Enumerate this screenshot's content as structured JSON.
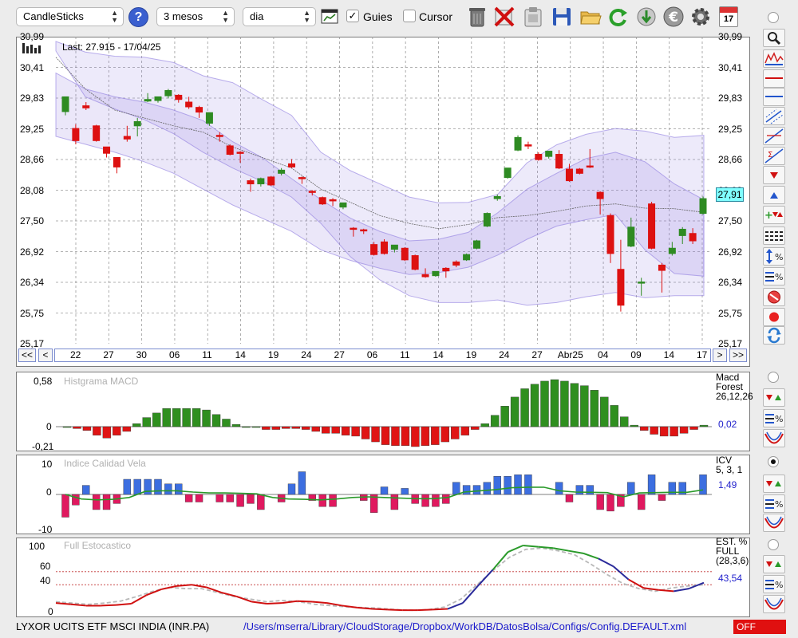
{
  "toolbar": {
    "chart_type": "CandleSticks",
    "period": "3 mesos",
    "interval": "dia",
    "guides_label": "Guies",
    "guides_checked": true,
    "cursor_label": "Cursor",
    "cursor_checked": false,
    "calendar_day": "17"
  },
  "price_chart": {
    "last_text": "Last: 27.915 - 17/04/25",
    "last_value_label": "27,91",
    "y_labels": [
      "30,99",
      "30,41",
      "29,83",
      "29,25",
      "28,66",
      "28,08",
      "27,50",
      "26,92",
      "26,34",
      "25,75",
      "25,17"
    ],
    "x_labels": [
      "22",
      "27",
      "30",
      "06",
      "11",
      "14",
      "19",
      "24",
      "27",
      "06",
      "11",
      "14",
      "19",
      "24",
      "27",
      "Abr25",
      "04",
      "09",
      "14",
      "17"
    ],
    "nav_buttons": [
      "<<",
      "<",
      ">",
      ">>"
    ]
  },
  "macd": {
    "title": "Histgrama MACD",
    "y_labels": [
      "0,58",
      "0",
      "-0,21"
    ],
    "info_lines": [
      "Macd",
      "Forest",
      "26,12,26"
    ],
    "value": "0,02"
  },
  "icv": {
    "title": "Indice Calidad Vela",
    "y_labels": [
      "10",
      "0",
      "-10"
    ],
    "info_lines": [
      "ICV",
      "5, 3, 1"
    ],
    "value": "1,49"
  },
  "stoch": {
    "title": "Full Estocastico",
    "y_labels": [
      "100",
      "60",
      "40",
      "0"
    ],
    "info_lines": [
      "EST. %",
      "FULL",
      "(28,3,6)"
    ],
    "value": "43,54"
  },
  "status": {
    "instrument": "LYXOR UCITS ETF MSCI INDIA (INR.PA)",
    "config_path": "/Users/mserra/Library/CloudStorage/Dropbox/WorkDB/DatosBolsa/Configs/Config.DEFAULT.xml",
    "state": "OFF"
  },
  "colors": {
    "up": "#2e8b22",
    "down": "#dd1111",
    "band": "#8e7ce0",
    "macd_up": "#2f8f1f",
    "macd_down": "#e01414",
    "icv_up": "#3c6ee0",
    "icv_down": "#e0195f",
    "status_off": "#e01010"
  },
  "chart_data": {
    "type": "candlestick",
    "ylim": [
      25.17,
      30.99
    ],
    "candles": [
      {
        "o": 29.57,
        "h": 29.62,
        "c": 29.85,
        "l": 29.5
      },
      {
        "o": 29.25,
        "h": 29.33,
        "c": 29.02,
        "l": 28.95
      },
      {
        "o": 29.68,
        "h": 29.75,
        "c": 29.64,
        "l": 29.6
      },
      {
        "o": 29.3,
        "h": 29.32,
        "c": 29.02,
        "l": 29.0
      },
      {
        "o": 28.9,
        "h": 28.9,
        "c": 28.78,
        "l": 28.7
      },
      {
        "o": 28.7,
        "h": 28.7,
        "c": 28.52,
        "l": 28.4
      },
      {
        "o": 29.1,
        "h": 29.3,
        "c": 29.05,
        "l": 29.0
      },
      {
        "o": 29.3,
        "h": 29.45,
        "c": 29.38,
        "l": 29.1
      },
      {
        "o": 29.77,
        "h": 29.92,
        "c": 29.8,
        "l": 29.75
      },
      {
        "o": 29.78,
        "h": 29.8,
        "c": 29.85,
        "l": 29.74
      },
      {
        "o": 29.87,
        "h": 30.0,
        "c": 29.97,
        "l": 29.82
      },
      {
        "o": 29.88,
        "h": 29.9,
        "c": 29.8,
        "l": 29.74
      },
      {
        "o": 29.75,
        "h": 29.85,
        "c": 29.66,
        "l": 29.62
      },
      {
        "o": 29.65,
        "h": 29.68,
        "c": 29.56,
        "l": 29.45
      },
      {
        "o": 29.35,
        "h": 29.55,
        "c": 29.55,
        "l": 29.3
      },
      {
        "o": 29.12,
        "h": 29.18,
        "c": 29.1,
        "l": 29.0
      },
      {
        "o": 28.92,
        "h": 28.95,
        "c": 28.76,
        "l": 28.74
      },
      {
        "o": 28.8,
        "h": 28.82,
        "c": 28.78,
        "l": 28.6
      },
      {
        "o": 28.26,
        "h": 28.3,
        "c": 28.2,
        "l": 28.05
      },
      {
        "o": 28.2,
        "h": 28.32,
        "c": 28.3,
        "l": 28.15
      },
      {
        "o": 28.33,
        "h": 28.35,
        "c": 28.18,
        "l": 28.16
      },
      {
        "o": 28.4,
        "h": 28.5,
        "c": 28.46,
        "l": 28.36
      },
      {
        "o": 28.58,
        "h": 28.67,
        "c": 28.52,
        "l": 28.5
      },
      {
        "o": 28.32,
        "h": 28.34,
        "c": 28.3,
        "l": 28.2
      },
      {
        "o": 28.06,
        "h": 28.08,
        "c": 28.04,
        "l": 27.98
      },
      {
        "o": 27.94,
        "h": 27.96,
        "c": 27.82,
        "l": 27.8
      },
      {
        "o": 27.9,
        "h": 27.93,
        "c": 27.88,
        "l": 27.78
      },
      {
        "o": 27.76,
        "h": 27.84,
        "c": 27.84,
        "l": 27.72
      },
      {
        "o": 27.36,
        "h": 27.38,
        "c": 27.34,
        "l": 27.2
      },
      {
        "o": 27.33,
        "h": 27.35,
        "c": 27.32,
        "l": 27.25
      },
      {
        "o": 27.05,
        "h": 27.1,
        "c": 26.86,
        "l": 26.84
      },
      {
        "o": 27.1,
        "h": 27.15,
        "c": 26.88,
        "l": 26.86
      },
      {
        "o": 26.96,
        "h": 27.0,
        "c": 27.04,
        "l": 26.9
      },
      {
        "o": 26.98,
        "h": 27.0,
        "c": 26.76,
        "l": 26.74
      },
      {
        "o": 26.84,
        "h": 26.86,
        "c": 26.58,
        "l": 26.56
      },
      {
        "o": 26.48,
        "h": 26.6,
        "c": 26.44,
        "l": 26.42
      },
      {
        "o": 26.46,
        "h": 26.5,
        "c": 26.54,
        "l": 26.44
      },
      {
        "o": 26.6,
        "h": 26.62,
        "c": 26.55,
        "l": 26.42
      },
      {
        "o": 26.72,
        "h": 26.75,
        "c": 26.66,
        "l": 26.62
      },
      {
        "o": 26.76,
        "h": 26.88,
        "c": 26.86,
        "l": 26.74
      },
      {
        "o": 26.98,
        "h": 27.14,
        "c": 27.12,
        "l": 26.96
      },
      {
        "o": 27.4,
        "h": 27.66,
        "c": 27.64,
        "l": 27.38
      },
      {
        "o": 27.92,
        "h": 28.0,
        "c": 27.96,
        "l": 27.88
      },
      {
        "o": 28.32,
        "h": 28.34,
        "c": 28.5,
        "l": 28.3
      },
      {
        "o": 28.84,
        "h": 29.12,
        "c": 29.08,
        "l": 28.82
      },
      {
        "o": 28.94,
        "h": 29.0,
        "c": 28.92,
        "l": 28.86
      },
      {
        "o": 28.76,
        "h": 28.8,
        "c": 28.66,
        "l": 28.64
      },
      {
        "o": 28.72,
        "h": 28.82,
        "c": 28.82,
        "l": 28.68
      },
      {
        "o": 28.76,
        "h": 28.84,
        "c": 28.5,
        "l": 28.48
      },
      {
        "o": 28.48,
        "h": 28.58,
        "c": 28.26,
        "l": 28.24
      },
      {
        "o": 28.48,
        "h": 28.5,
        "c": 28.4,
        "l": 28.38
      },
      {
        "o": 28.54,
        "h": 28.86,
        "c": 28.52,
        "l": 28.5
      },
      {
        "o": 28.04,
        "h": 28.06,
        "c": 27.92,
        "l": 27.62
      },
      {
        "o": 27.6,
        "h": 27.64,
        "c": 26.88,
        "l": 26.7
      },
      {
        "o": 26.58,
        "h": 27.14,
        "c": 25.9,
        "l": 25.78
      },
      {
        "o": 27.02,
        "h": 27.56,
        "c": 27.38,
        "l": 27.0
      },
      {
        "o": 26.34,
        "h": 26.42,
        "c": 26.34,
        "l": 26.08
      },
      {
        "o": 27.82,
        "h": 27.86,
        "c": 26.98,
        "l": 26.96
      },
      {
        "o": 26.66,
        "h": 26.7,
        "c": 26.56,
        "l": 26.14
      },
      {
        "o": 26.88,
        "h": 27.1,
        "c": 26.98,
        "l": 26.84
      },
      {
        "o": 27.22,
        "h": 27.38,
        "c": 27.34,
        "l": 27.06
      },
      {
        "o": 27.26,
        "h": 27.36,
        "c": 27.12,
        "l": 27.06
      },
      {
        "o": 27.64,
        "h": 27.96,
        "c": 27.92,
        "l": 27.62
      }
    ],
    "bands": {
      "upper": [
        30.9,
        30.7,
        30.62,
        30.6,
        30.5,
        30.25,
        30.12,
        29.8,
        29.5,
        28.8,
        28.45,
        28.2,
        27.95,
        27.84,
        27.85,
        28.0,
        28.6,
        28.94,
        29.14,
        29.25,
        29.2,
        29.08,
        29.12
      ],
      "upper2": [
        30.3,
        30.0,
        29.85,
        29.75,
        29.6,
        29.4,
        29.0,
        28.7,
        28.3,
        27.9,
        27.55,
        27.3,
        27.12,
        27.15,
        27.28,
        27.65,
        28.1,
        28.4,
        28.68,
        28.8,
        28.62,
        28.2,
        27.9
      ],
      "middle": [
        30.6,
        30.0,
        29.6,
        29.45,
        29.3,
        29.18,
        28.9,
        28.7,
        28.5,
        28.1,
        27.85,
        27.6,
        27.45,
        27.35,
        27.43,
        27.56,
        27.6,
        27.68,
        27.78,
        27.82,
        27.74,
        27.73,
        27.66
      ],
      "lower2": [
        29.1,
        28.95,
        28.8,
        28.62,
        28.4,
        28.1,
        27.8,
        27.55,
        27.3,
        26.95,
        26.75,
        26.6,
        26.48,
        26.52,
        26.62,
        26.85,
        27.15,
        27.4,
        27.52,
        27.62,
        26.95,
        26.5,
        26.45
      ],
      "lower": [
        30.72,
        29.85,
        29.62,
        29.42,
        29.15,
        28.8,
        28.5,
        28.25,
        27.95,
        27.45,
        26.82,
        26.38,
        26.08,
        25.95,
        25.95,
        26.0,
        25.9,
        25.95,
        26.06,
        26.14,
        26.04,
        26.08,
        26.08
      ]
    },
    "macd_hist": [
      0.0,
      -0.02,
      -0.04,
      -0.09,
      -0.12,
      -0.09,
      -0.05,
      0.04,
      0.12,
      0.18,
      0.24,
      0.24,
      0.24,
      0.24,
      0.22,
      0.16,
      0.1,
      0.03,
      0.0,
      0.0,
      -0.03,
      -0.03,
      -0.02,
      -0.02,
      -0.03,
      -0.05,
      -0.07,
      -0.07,
      -0.09,
      -0.1,
      -0.13,
      -0.16,
      -0.19,
      -0.2,
      -0.2,
      -0.21,
      -0.2,
      -0.19,
      -0.16,
      -0.13,
      -0.09,
      -0.03,
      0.04,
      0.15,
      0.27,
      0.39,
      0.5,
      0.56,
      0.6,
      0.62,
      0.6,
      0.57,
      0.54,
      0.48,
      0.39,
      0.28,
      0.13,
      0.02,
      -0.04,
      -0.08,
      -0.1,
      -0.1,
      -0.07,
      -0.03,
      0.02
    ],
    "icv_bars": [
      -7.5,
      -3.5,
      3.0,
      -5.0,
      -5.0,
      -3.0,
      5.0,
      5.0,
      5.0,
      5.0,
      3.5,
      3.5,
      -2.5,
      -2.5,
      0,
      -2.5,
      -2.5,
      -4.0,
      -3.0,
      -5.0,
      0,
      -2.5,
      3.5,
      7.5,
      -2.0,
      -4.0,
      -4.0,
      0,
      0,
      -2.0,
      -6.0,
      2.5,
      -5.0,
      2.0,
      -3.0,
      -4.0,
      -4.0,
      -3.0,
      4.0,
      3.0,
      3.0,
      4.0,
      6.0,
      6.0,
      6.5,
      6.5,
      0,
      0,
      4.0,
      -2.5,
      3.0,
      3.0,
      -5.0,
      -5.5,
      -4.0,
      4.0,
      -5.0,
      6.5,
      -2.0,
      4.0,
      4.0,
      0,
      6.5
    ],
    "stoch_k": [
      12,
      10,
      8,
      8,
      9,
      11,
      24,
      33,
      38,
      40,
      36,
      28,
      22,
      14,
      11,
      12,
      15,
      14,
      12,
      8,
      5,
      3,
      2,
      1,
      1,
      2,
      3,
      12,
      38,
      63,
      90,
      100,
      98,
      96,
      92,
      88,
      80,
      68,
      48,
      35,
      32,
      30,
      34,
      43
    ],
    "stoch_d": [
      14,
      12,
      10,
      12,
      15,
      22,
      30,
      36,
      34,
      34,
      28,
      22,
      18,
      14,
      16,
      14,
      10,
      8,
      6,
      5,
      4,
      2,
      1,
      2,
      6,
      18,
      40,
      62,
      82,
      94,
      96,
      92,
      86,
      72,
      56,
      42,
      34,
      30,
      35,
      38,
      40
    ]
  }
}
